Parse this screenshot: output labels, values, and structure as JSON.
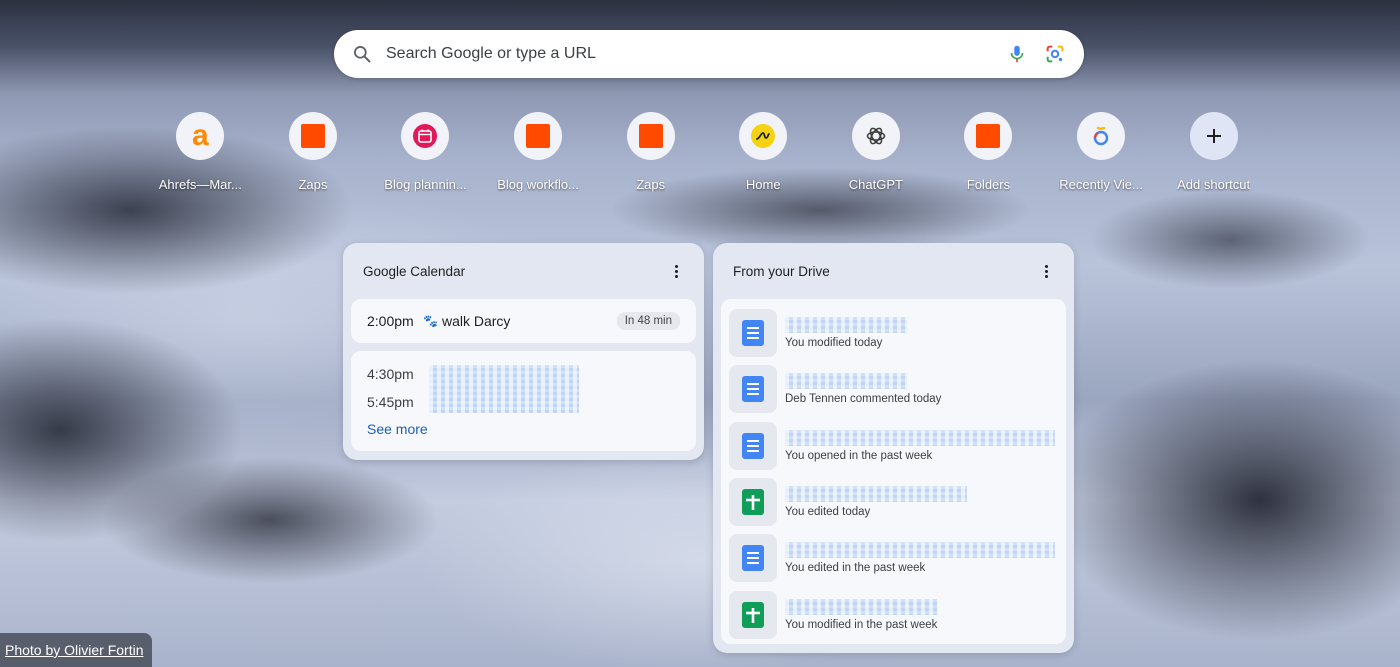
{
  "search": {
    "placeholder": "Search Google or type a URL"
  },
  "shortcuts": [
    {
      "label": "Ahrefs—Mar...",
      "icon": "ahrefs-icon"
    },
    {
      "label": "Zaps",
      "icon": "zapier-square-icon"
    },
    {
      "label": "Blog plannin...",
      "icon": "calendar-app-icon"
    },
    {
      "label": "Blog workflo...",
      "icon": "zapier-square-icon"
    },
    {
      "label": "Zaps",
      "icon": "zapier-square-icon"
    },
    {
      "label": "Home",
      "icon": "yellow-circle-logo-icon"
    },
    {
      "label": "ChatGPT",
      "icon": "openai-icon"
    },
    {
      "label": "Folders",
      "icon": "zapier-square-icon"
    },
    {
      "label": "Recently Vie...",
      "icon": "colorful-ring-icon"
    },
    {
      "label": "Add shortcut",
      "icon": "plus-icon"
    }
  ],
  "calendar": {
    "title": "Google Calendar",
    "next_event": {
      "time": "2:00pm",
      "emoji": "🐾",
      "name": "walk Darcy",
      "badge": "In 48 min"
    },
    "later_times": [
      "4:30pm",
      "5:45pm"
    ],
    "see_more": "See more"
  },
  "drive": {
    "title": "From your Drive",
    "files": [
      {
        "type": "doc",
        "activity": "You modified today"
      },
      {
        "type": "doc",
        "activity": "Deb Tennen commented today"
      },
      {
        "type": "doc",
        "activity": "You opened in the past week"
      },
      {
        "type": "sheet",
        "activity": "You edited today"
      },
      {
        "type": "doc",
        "activity": "You edited in the past week"
      },
      {
        "type": "sheet",
        "activity": "You modified in the past week"
      }
    ]
  },
  "credit": "Photo by Olivier Fortin",
  "colors": {
    "accent": "#1a5fb4",
    "zapier_orange": "#ff4a00",
    "doc_blue": "#4285f4",
    "sheet_green": "#0f9d58"
  }
}
